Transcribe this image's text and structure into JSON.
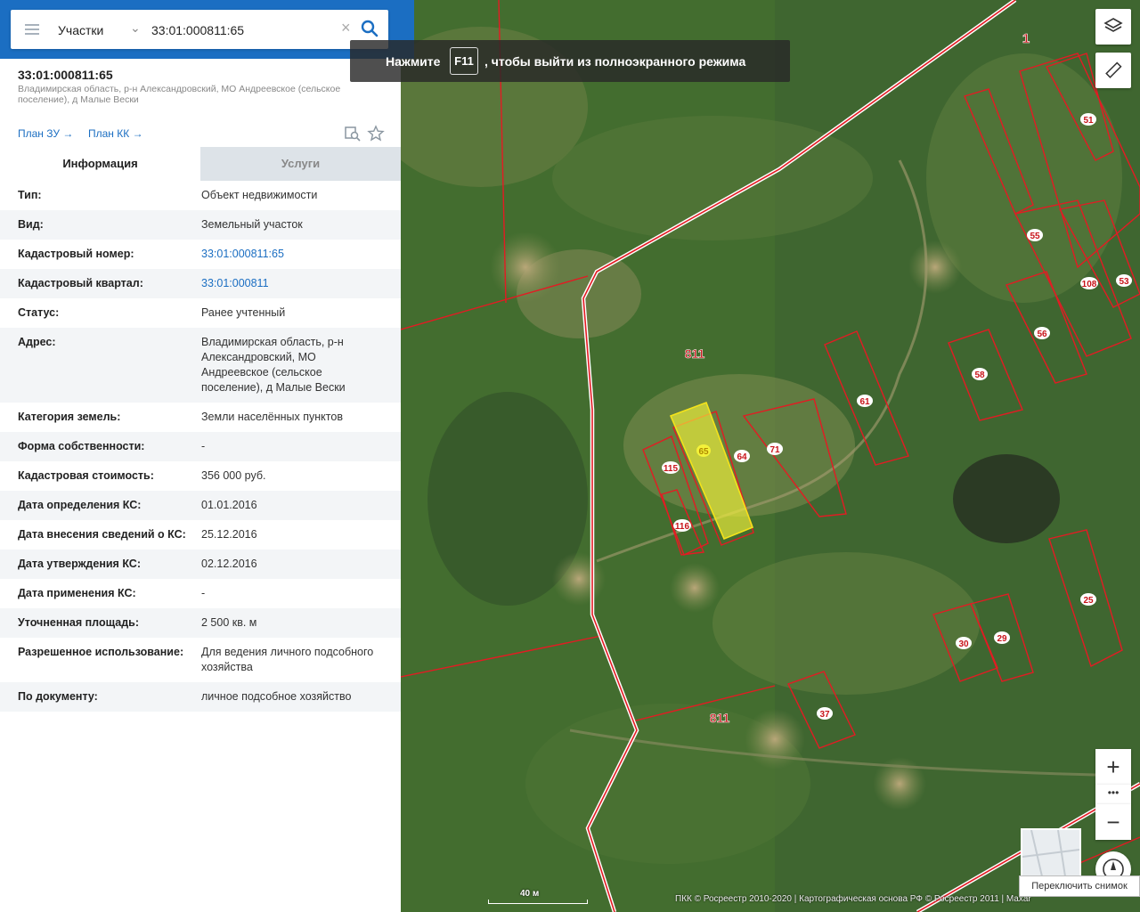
{
  "search": {
    "layer_select": "Участки",
    "query": "33:01:000811:65"
  },
  "object": {
    "title": "33:01:000811:65",
    "address": "Владимирская область, р-н Александровский, МО Андреевское (сельское поселение), д Малые Вески"
  },
  "links": {
    "plan_zu": "План ЗУ →",
    "plan_kk": "План КК →"
  },
  "tabs": {
    "info": "Информация",
    "services": "Услуги"
  },
  "info_rows": [
    {
      "key": "Тип:",
      "value": "Объект недвижимости",
      "link": false
    },
    {
      "key": "Вид:",
      "value": "Земельный участок",
      "link": false
    },
    {
      "key": "Кадастровый номер:",
      "value": "33:01:000811:65",
      "link": true
    },
    {
      "key": "Кадастровый квартал:",
      "value": "33:01:000811",
      "link": true
    },
    {
      "key": "Статус:",
      "value": "Ранее учтенный",
      "link": false
    },
    {
      "key": "Адрес:",
      "value": "Владимирская область, р-н Александровский, МО Андреевское (сельское поселение), д Малые Вески",
      "link": false
    },
    {
      "key": "Категория земель:",
      "value": "Земли населённых пунктов",
      "link": false
    },
    {
      "key": "Форма собственности:",
      "value": "-",
      "link": false
    },
    {
      "key": "Кадастровая стоимость:",
      "value": "356 000 руб.",
      "link": false
    },
    {
      "key": "Дата определения КС:",
      "value": "01.01.2016",
      "link": false
    },
    {
      "key": "Дата внесения сведений о КС:",
      "value": "25.12.2016",
      "link": false
    },
    {
      "key": "Дата утверждения КС:",
      "value": "02.12.2016",
      "link": false
    },
    {
      "key": "Дата применения КС:",
      "value": "-",
      "link": false
    },
    {
      "key": "Уточненная площадь:",
      "value": "2 500 кв. м",
      "link": false
    },
    {
      "key": "Разрешенное использование:",
      "value": "Для ведения личного подсобного хозяйства",
      "link": false
    },
    {
      "key": "По документу:",
      "value": "личное подсобное хозяйство",
      "link": false
    }
  ],
  "fullscreen_hint": {
    "before": "Нажмите",
    "key": "F11",
    "after": ", чтобы выйти из полноэкранного режима"
  },
  "map": {
    "labels": [
      "1",
      "51",
      "55",
      "108",
      "53",
      "56",
      "58",
      "811",
      "61",
      "65",
      "64",
      "71",
      "115",
      "116",
      "25",
      "30",
      "29",
      "37",
      "811"
    ],
    "scale": "40 м",
    "copyright": "ПКК © Росреестр 2010-2020 | Картографическая основа РФ © Росреестр 2011 | Maxar",
    "switch_tooltip": "Переключить снимок",
    "zoom_in": "+",
    "zoom_more": "•••",
    "zoom_out": "−"
  },
  "colors": {
    "brand_blue": "#1b6ec2",
    "parcel_red": "#e31b23",
    "selected_fill": "#f4f23a"
  }
}
